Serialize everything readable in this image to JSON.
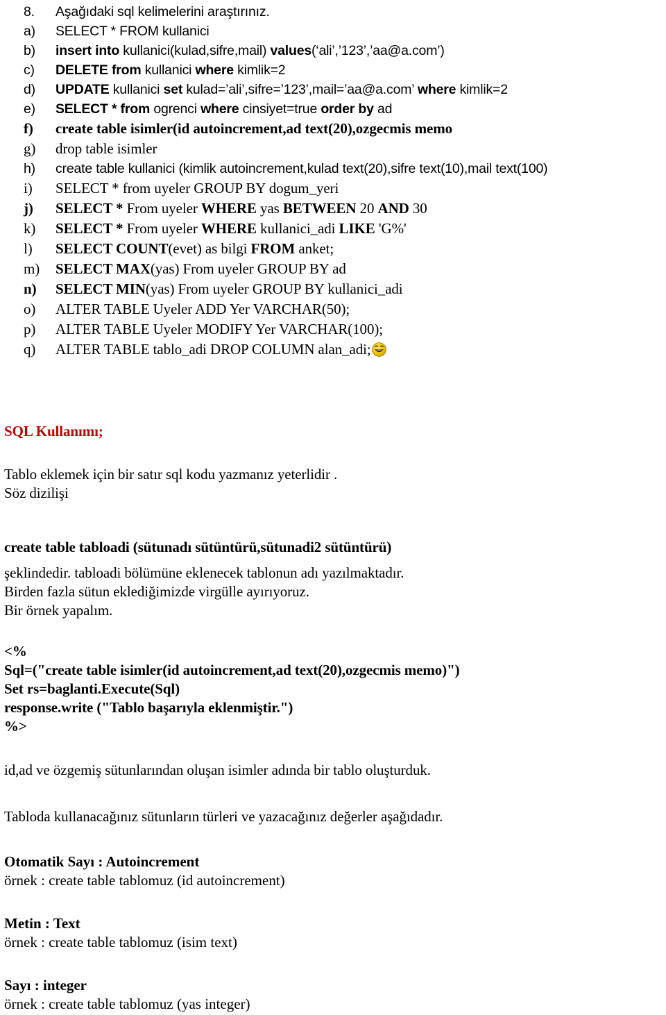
{
  "document": {
    "question_number": "8.",
    "question_text": "Aşağıdaki sql kelimelerini araştırınız.",
    "items": [
      {
        "marker": "a)",
        "text": "SELECT * FROM kullanici"
      },
      {
        "marker": "b)",
        "text": "insert into kullanici(kulad,sifre,mail) values(‘ali’,’123’,’aa@a.com’)"
      },
      {
        "marker": "c)",
        "text": "DELETE from kullanici where kimlik=2"
      },
      {
        "marker": "d)",
        "text": "UPDATE kullanici set kulad=’ali’,sifre=’123’,mail=’aa@a.com’ where kimlik=2"
      },
      {
        "marker": "e)",
        "text": "SELECT * from ogrenci where cinsiyet=true order by ad"
      },
      {
        "marker": "f)",
        "text": "create table isimler(id autoincrement,ad text(20),ozgecmis memo"
      },
      {
        "marker": "g)",
        "text": "drop table isimler"
      },
      {
        "marker": "h)",
        "text": "create table kullanici (kimlik autoincrement,kulad text(20),sifre text(10),mail text(100)"
      },
      {
        "marker": "i)",
        "text": "SELECT * from uyeler GROUP BY dogum_yeri"
      },
      {
        "marker": "j)",
        "text": "SELECT * From uyeler WHERE yas BETWEEN 20 AND 30"
      },
      {
        "marker": "k)",
        "text": "SELECT * From uyeler WHERE kullanici_adi LIKE 'G%'"
      },
      {
        "marker": "l)",
        "text": "SELECT COUNT(evet)  as bilgi FROM anket;"
      },
      {
        "marker": "m)",
        "text": "SELECT MAX(yas) From uyeler GROUP BY ad"
      },
      {
        "marker": "n)",
        "text": "SELECT MIN(yas) From uyeler GROUP BY kullanici_adi"
      },
      {
        "marker": "o)",
        "text": "ALTER TABLE Uyeler ADD Yer VARCHAR(50);"
      },
      {
        "marker": "p)",
        "text": "ALTER TABLE Uyeler MODIFY Yer VARCHAR(100);"
      },
      {
        "marker": "q)",
        "text": "ALTER TABLE tablo_adi DROP COLUMN alan_adi;"
      }
    ],
    "item_parts": {
      "a": [
        {
          "t": "SELECT * FROM kullanici",
          "b": false
        }
      ],
      "b": [
        {
          "t": "insert into ",
          "b": true
        },
        {
          "t": "kullanici(kulad,sifre,mail) ",
          "b": false
        },
        {
          "t": "values",
          "b": true
        },
        {
          "t": "(‘ali’,’123’,’aa@a.com’)",
          "b": false
        }
      ],
      "c": [
        {
          "t": "DELETE from ",
          "b": true
        },
        {
          "t": "kullanici ",
          "b": false
        },
        {
          "t": "where ",
          "b": true
        },
        {
          "t": "kimlik=2",
          "b": false
        }
      ],
      "d": [
        {
          "t": "UPDATE ",
          "b": true
        },
        {
          "t": "kullanici ",
          "b": false
        },
        {
          "t": "set ",
          "b": true
        },
        {
          "t": "kulad=’ali’,sifre=’123’,mail=’aa@a.com’ ",
          "b": false
        },
        {
          "t": "where ",
          "b": true
        },
        {
          "t": "kimlik=2",
          "b": false
        }
      ],
      "e": [
        {
          "t": "SELECT * from ",
          "b": true
        },
        {
          "t": "ogrenci ",
          "b": false
        },
        {
          "t": "where ",
          "b": true
        },
        {
          "t": "cinsiyet=true ",
          "b": false
        },
        {
          "t": "order by ",
          "b": true
        },
        {
          "t": "ad",
          "b": false
        }
      ],
      "f": [
        {
          "t": "create table isimler(id autoincrement,ad text(20),ozgecmis memo",
          "b": true
        }
      ],
      "g": [
        {
          "t": "drop table isimler",
          "b": false
        }
      ],
      "h": [
        {
          "t": "create table kullanici (kimlik autoincrement,kulad text(20),sifre text(10),mail text(100)",
          "b": false
        }
      ],
      "i": [
        {
          "t": "SELECT * from uyeler GROUP BY dogum_yeri",
          "b": false
        }
      ],
      "j": [
        {
          "t": "SELECT * ",
          "b": true
        },
        {
          "t": "From uyeler ",
          "b": false
        },
        {
          "t": "WHERE ",
          "b": true
        },
        {
          "t": "yas ",
          "b": false
        },
        {
          "t": "BETWEEN ",
          "b": true
        },
        {
          "t": "20 ",
          "b": false
        },
        {
          "t": "AND ",
          "b": true
        },
        {
          "t": "30",
          "b": false
        }
      ],
      "k": [
        {
          "t": "SELECT * ",
          "b": true
        },
        {
          "t": "From uyeler ",
          "b": false
        },
        {
          "t": "WHERE ",
          "b": true
        },
        {
          "t": "kullanici_adi ",
          "b": false
        },
        {
          "t": "LIKE ",
          "b": true
        },
        {
          "t": "'G%'",
          "b": false
        }
      ],
      "l": [
        {
          "t": "SELECT COUNT",
          "b": true
        },
        {
          "t": "(evet)  as bilgi ",
          "b": false
        },
        {
          "t": "FROM ",
          "b": true
        },
        {
          "t": "anket;",
          "b": false
        }
      ],
      "m": [
        {
          "t": "SELECT MAX",
          "b": true
        },
        {
          "t": "(yas) From uyeler GROUP BY ad",
          "b": false
        }
      ],
      "n": [
        {
          "t": "SELECT MIN",
          "b": true
        },
        {
          "t": "(yas) From uyeler GROUP BY kullanici_adi",
          "b": false
        }
      ],
      "o": [
        {
          "t": "ALTER TABLE Uyeler ADD Yer VARCHAR(50);",
          "b": false
        }
      ],
      "p": [
        {
          "t": "ALTER TABLE Uyeler MODIFY Yer VARCHAR(100);",
          "b": false
        }
      ],
      "q": [
        {
          "t": "ALTER TABLE tablo_adi DROP COLUMN alan_adi;",
          "b": false
        }
      ]
    },
    "section_heading": "SQL Kullanımı;",
    "intro_paragraph": "Tablo eklemek için bir satır sql kodu yazmanız yeterlidir .\nSöz dizilişi",
    "syntax_line": "create table tabloadi (sütunadı sütüntürü,sütunadi2 sütüntürü)",
    "explanation_paragraph": "şeklindedir. tabloadi bölümüne eklenecek tablonun adı yazılmaktadır.\nBirden fazla sütun eklediğimizde virgülle ayırıyoruz.\nBir örnek yapalım.",
    "code_block": "<%\nSql=(\"create table isimler(id autoincrement,ad text(20),ozgecmis memo)\")\nSet rs=baglanti.Execute(Sql)\nresponse.write (\"Tablo başarıyla eklenmiştir.\")\n%>",
    "after_code_paragraph": "id,ad ve özgemiş sütunlarından oluşan isimler adında bir tablo oluşturduk.",
    "types_intro_paragraph": "Tabloda kullanacağınız sütunların türleri ve yazacağınız değerler aşağıdadır.",
    "types": [
      {
        "title": "Otomatik Sayı : Autoincrement",
        "example": "örnek : create table tablomuz (id autoincrement)"
      },
      {
        "title": "Metin : Text",
        "example": "örnek : create table tablomuz (isim text)"
      },
      {
        "title": "Sayı :  integer",
        "example": "örnek : create table tablomuz (yas integer)"
      }
    ],
    "colors": {
      "heading_red": "#C00000",
      "body_black": "#000000",
      "page_background": "#FFFFFF",
      "smiley_yellow": "#F2C200"
    },
    "smiley_icon_name": "laughing-smiley-emoji"
  }
}
